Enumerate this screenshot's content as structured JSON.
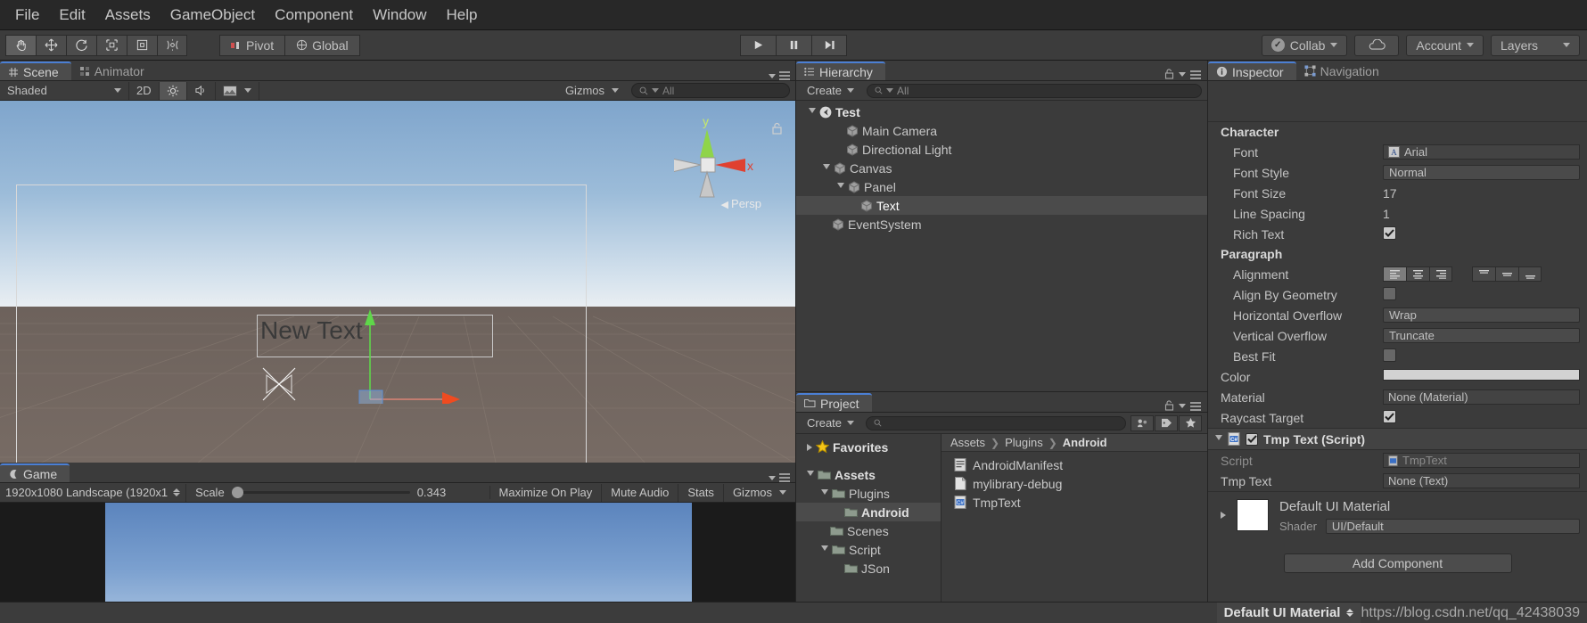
{
  "menubar": {
    "items": [
      "File",
      "Edit",
      "Assets",
      "GameObject",
      "Component",
      "Window",
      "Help"
    ]
  },
  "toolbar": {
    "transform_tools": [
      "hand-tool",
      "move-tool",
      "rotate-tool",
      "scale-tool",
      "rect-tool",
      "transform-tool"
    ],
    "pivot_label": "Pivot",
    "global_label": "Global",
    "play_label": "play",
    "pause_label": "pause",
    "step_label": "step",
    "collab_label": "Collab",
    "cloud_label": "cloud",
    "account_label": "Account",
    "layers_label": "Layers"
  },
  "scene_panel": {
    "tabs": [
      {
        "label": "Scene",
        "icon": "scene-icon",
        "active": true
      },
      {
        "label": "Animator",
        "icon": "animator-icon",
        "active": false
      }
    ],
    "shading_mode": "Shaded",
    "mode_2d": "2D",
    "gizmos_label": "Gizmos",
    "search_placeholder": "All",
    "search_value": "",
    "viewport": {
      "text_object_label": "New Text",
      "persp_label": "Persp",
      "axis_y": "y",
      "axis_x": "x"
    }
  },
  "game_panel": {
    "tab_label": "Game",
    "aspect": "1920x1080 Landscape (1920x1",
    "scale_label": "Scale",
    "scale_value": "0.343",
    "maximize_label": "Maximize On Play",
    "mute_label": "Mute Audio",
    "stats_label": "Stats",
    "gizmos_label": "Gizmos"
  },
  "hierarchy": {
    "tab_label": "Hierarchy",
    "create_label": "Create",
    "search_placeholder": "All",
    "items": [
      {
        "label": "Test",
        "depth": 0,
        "expanded": true,
        "icon": "unity-scene-icon",
        "selected": false
      },
      {
        "label": "Main Camera",
        "depth": 2,
        "expanded": null,
        "icon": "gameobject-icon",
        "selected": false
      },
      {
        "label": "Directional Light",
        "depth": 2,
        "expanded": null,
        "icon": "gameobject-icon",
        "selected": false
      },
      {
        "label": "Canvas",
        "depth": 1,
        "expanded": true,
        "icon": "gameobject-icon",
        "selected": false
      },
      {
        "label": "Panel",
        "depth": 2,
        "expanded": true,
        "icon": "gameobject-icon",
        "selected": false
      },
      {
        "label": "Text",
        "depth": 3,
        "expanded": null,
        "icon": "gameobject-icon",
        "selected": true
      },
      {
        "label": "EventSystem",
        "depth": 1,
        "expanded": null,
        "icon": "gameobject-icon",
        "selected": false
      }
    ]
  },
  "project": {
    "tab_label": "Project",
    "create_label": "Create",
    "search_placeholder": "",
    "tree": [
      {
        "label": "Favorites",
        "depth": 0,
        "expanded": false,
        "icon": "star-icon",
        "bold": true,
        "selected": false
      },
      {
        "label": "",
        "depth": 0,
        "expanded": null,
        "icon": "spacer",
        "bold": false,
        "selected": false
      },
      {
        "label": "Assets",
        "depth": 0,
        "expanded": true,
        "icon": "folder-icon",
        "bold": true,
        "selected": false
      },
      {
        "label": "Plugins",
        "depth": 1,
        "expanded": true,
        "icon": "folder-icon",
        "bold": false,
        "selected": false
      },
      {
        "label": "Android",
        "depth": 2,
        "expanded": null,
        "icon": "folder-icon",
        "bold": true,
        "selected": true
      },
      {
        "label": "Scenes",
        "depth": 1,
        "expanded": null,
        "icon": "folder-icon",
        "bold": false,
        "selected": false
      },
      {
        "label": "Script",
        "depth": 1,
        "expanded": true,
        "icon": "folder-icon",
        "bold": false,
        "selected": false
      },
      {
        "label": "JSon",
        "depth": 2,
        "expanded": null,
        "icon": "folder-icon",
        "bold": false,
        "selected": false
      }
    ],
    "breadcrumb": [
      "Assets",
      "Plugins",
      "Android"
    ],
    "files": [
      {
        "label": "AndroidManifest",
        "icon": "xml-file-icon"
      },
      {
        "label": "mylibrary-debug",
        "icon": "generic-file-icon"
      },
      {
        "label": "TmpText",
        "icon": "csharp-file-icon"
      }
    ]
  },
  "inspector": {
    "tabs": [
      {
        "label": "Inspector",
        "icon": "info-icon",
        "active": true
      },
      {
        "label": "Navigation",
        "icon": "navigation-icon",
        "active": false
      }
    ],
    "sections": [
      {
        "header": "Character",
        "rows": [
          {
            "label": "Font",
            "type": "object",
            "value": "Arial",
            "icon": "font-asset-icon"
          },
          {
            "label": "Font Style",
            "type": "enum",
            "value": "Normal"
          },
          {
            "label": "Font Size",
            "type": "number",
            "value": "17"
          },
          {
            "label": "Line Spacing",
            "type": "number",
            "value": "1"
          },
          {
            "label": "Rich Text",
            "type": "check",
            "value": "checked"
          }
        ]
      },
      {
        "header": "Paragraph",
        "rows": [
          {
            "label": "Alignment",
            "type": "align",
            "value": "left"
          },
          {
            "label": "Align By Geometry",
            "type": "check",
            "value": "unchecked"
          },
          {
            "label": "Horizontal Overflow",
            "type": "enum",
            "value": "Wrap"
          },
          {
            "label": "Vertical Overflow",
            "type": "enum",
            "value": "Truncate"
          },
          {
            "label": "Best Fit",
            "type": "check",
            "value": "unchecked"
          }
        ]
      },
      {
        "header": "",
        "rows": [
          {
            "label": "Color",
            "type": "color",
            "value": "#d2d2d2"
          },
          {
            "label": "Material",
            "type": "object",
            "value": "None (Material)"
          },
          {
            "label": "Raycast Target",
            "type": "check",
            "value": "checked"
          }
        ]
      }
    ],
    "component": {
      "title": "Tmp Text (Script)",
      "enabled": "checked",
      "icon": "csharp-file-icon",
      "rows": [
        {
          "label": "Script",
          "type": "object",
          "value": "TmpText",
          "icon": "csharp-file-icon",
          "disabled": true
        },
        {
          "label": "Tmp Text",
          "type": "object",
          "value": "None (Text)"
        }
      ]
    },
    "material_preview": {
      "name": "Default UI Material",
      "shader_label": "Shader",
      "shader_value": "UI/Default"
    },
    "add_component_label": "Add Component"
  },
  "statusbar": {
    "material_label": "Default UI Material",
    "url": "https://blog.csdn.net/qq_42438039"
  },
  "colors": {
    "accent_blue": "#4b7fd4",
    "panel_bg": "#3b3b3b",
    "toolbar_bg": "#3c3c3c",
    "selected_row": "#4b4b4b",
    "text": "#c8c8c8"
  }
}
